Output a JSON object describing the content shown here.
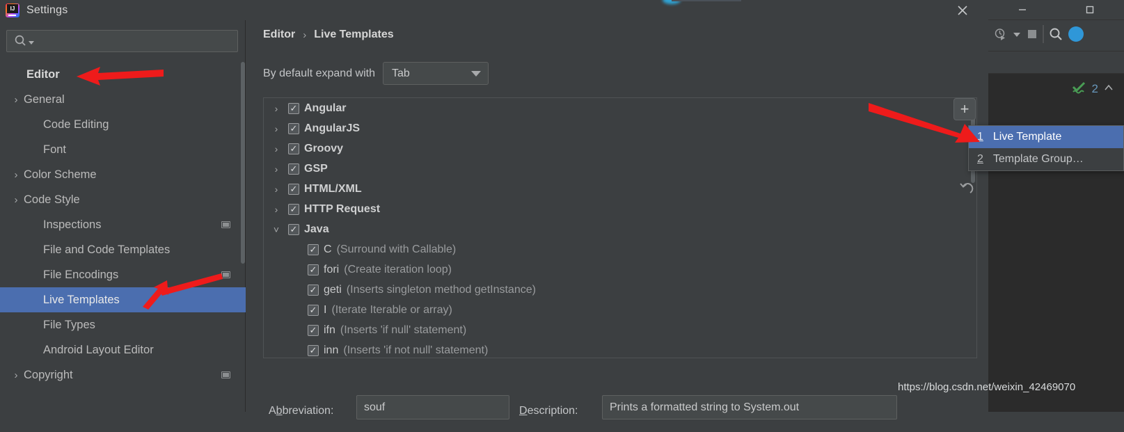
{
  "window": {
    "dialog_title": "Settings",
    "app_icon": "intellij-idea-icon",
    "close_label": "✕",
    "minimize_label": "—",
    "maximize_label": "□"
  },
  "ide": {
    "toolbar_icons": [
      "debug-icon",
      "chevron-down-icon",
      "stop-icon",
      "search-icon",
      "user-avatar-icon"
    ],
    "inspection_count": "2",
    "inspection_icon": "green-double-check-icon",
    "collapse_icon": "chevron-up-icon"
  },
  "search": {
    "placeholder": "",
    "value": "",
    "icon": "search-icon"
  },
  "sidebar": {
    "items": [
      {
        "label": "Editor",
        "indent": 0,
        "arrow": "",
        "selected": false,
        "root": true,
        "badge": false
      },
      {
        "label": "General",
        "indent": 1,
        "arrow": "›",
        "selected": false,
        "root": false,
        "badge": false
      },
      {
        "label": "Code Editing",
        "indent": 1,
        "arrow": "",
        "selected": false,
        "root": false,
        "badge": false
      },
      {
        "label": "Font",
        "indent": 1,
        "arrow": "",
        "selected": false,
        "root": false,
        "badge": false
      },
      {
        "label": "Color Scheme",
        "indent": 1,
        "arrow": "›",
        "selected": false,
        "root": false,
        "badge": false
      },
      {
        "label": "Code Style",
        "indent": 1,
        "arrow": "›",
        "selected": false,
        "root": false,
        "badge": false
      },
      {
        "label": "Inspections",
        "indent": 1,
        "arrow": "",
        "selected": false,
        "root": false,
        "badge": true
      },
      {
        "label": "File and Code Templates",
        "indent": 1,
        "arrow": "",
        "selected": false,
        "root": false,
        "badge": false
      },
      {
        "label": "File Encodings",
        "indent": 1,
        "arrow": "",
        "selected": false,
        "root": false,
        "badge": true
      },
      {
        "label": "Live Templates",
        "indent": 1,
        "arrow": "",
        "selected": true,
        "root": false,
        "badge": false
      },
      {
        "label": "File Types",
        "indent": 1,
        "arrow": "",
        "selected": false,
        "root": false,
        "badge": false
      },
      {
        "label": "Android Layout Editor",
        "indent": 1,
        "arrow": "",
        "selected": false,
        "root": false,
        "badge": false
      },
      {
        "label": "Copyright",
        "indent": 1,
        "arrow": "›",
        "selected": false,
        "root": false,
        "badge": true
      }
    ]
  },
  "main": {
    "breadcrumb": {
      "parent": "Editor",
      "separator": "›",
      "current": "Live Templates"
    },
    "expand_with": {
      "label": "By default expand with",
      "value": "Tab"
    },
    "tree": [
      {
        "type": "group",
        "arrow": "›",
        "checked": true,
        "name": "Angular"
      },
      {
        "type": "group",
        "arrow": "›",
        "checked": true,
        "name": "AngularJS"
      },
      {
        "type": "group",
        "arrow": "›",
        "checked": true,
        "name": "Groovy"
      },
      {
        "type": "group",
        "arrow": "›",
        "checked": true,
        "name": "GSP"
      },
      {
        "type": "group",
        "arrow": "›",
        "checked": true,
        "name": "HTML/XML"
      },
      {
        "type": "group",
        "arrow": "›",
        "checked": true,
        "name": "HTTP Request"
      },
      {
        "type": "group",
        "arrow": "˅",
        "checked": true,
        "name": "Java"
      },
      {
        "type": "item",
        "checked": true,
        "abbr": "C",
        "desc": "(Surround with Callable)"
      },
      {
        "type": "item",
        "checked": true,
        "abbr": "fori",
        "desc": "(Create iteration loop)"
      },
      {
        "type": "item",
        "checked": true,
        "abbr": "geti",
        "desc": "(Inserts singleton method getInstance)"
      },
      {
        "type": "item",
        "checked": true,
        "abbr": "I",
        "desc": "(Iterate Iterable or array)"
      },
      {
        "type": "item",
        "checked": true,
        "abbr": "ifn",
        "desc": "(Inserts 'if null' statement)"
      },
      {
        "type": "item",
        "checked": true,
        "abbr": "inn",
        "desc": "(Inserts 'if not null' statement)"
      }
    ],
    "buttons": {
      "add_label": "+",
      "add_name": "add-template-button",
      "undo_name": "revert-icon"
    },
    "fields": {
      "abbreviation_label": "Abbreviation:",
      "abbreviation_value": "souf",
      "description_label": "Description:",
      "description_value": "Prints a formatted string to System.out"
    }
  },
  "context_menu": {
    "items": [
      {
        "num": "1",
        "label": "Live Template",
        "highlighted": true
      },
      {
        "num": "2",
        "label": "Template Group…",
        "highlighted": false
      }
    ]
  },
  "watermark": {
    "text": "https://blog.csdn.net/weixin_42469070"
  },
  "colors": {
    "background": "#3c3f41",
    "selection": "#4b6eaf",
    "editor_background": "#2b2b2b",
    "annotation_red": "#ee1b1b",
    "accent_green": "#499c54",
    "accent_blue": "#6897bb"
  }
}
